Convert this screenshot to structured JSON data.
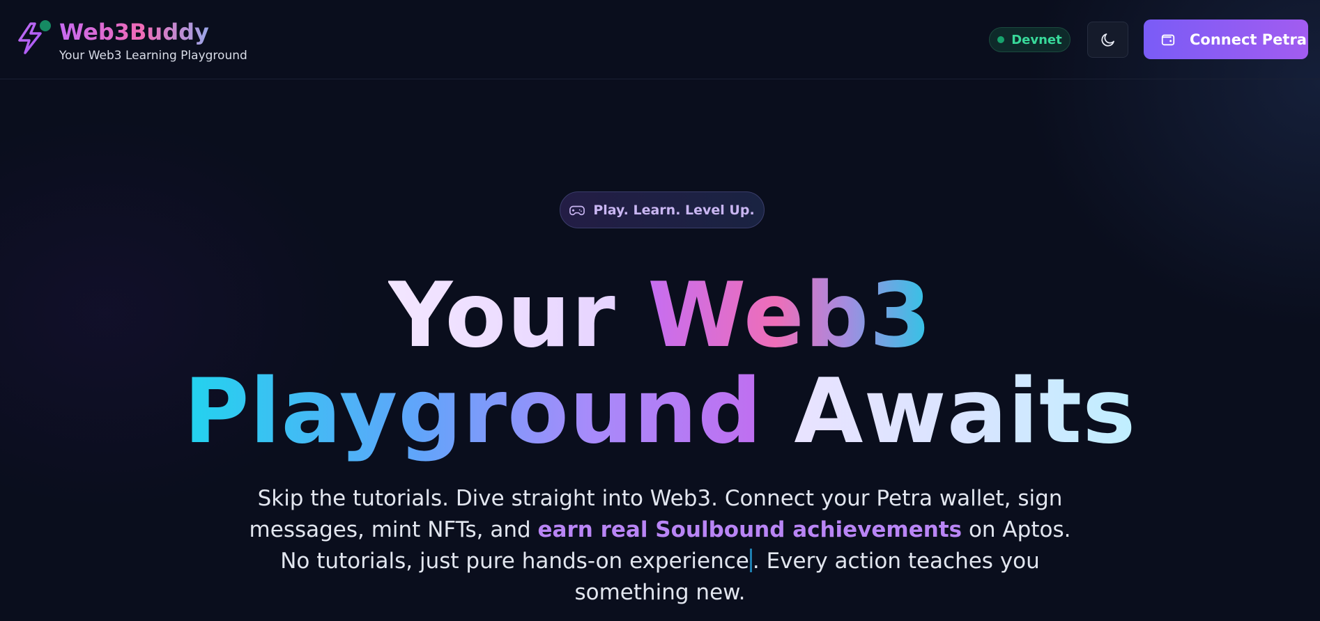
{
  "header": {
    "brand_title": "Web3Buddy",
    "brand_subtitle": "Your Web3 Learning Playground",
    "network_label": "Devnet",
    "connect_label": "Connect Petra",
    "status_color": "#17a36d",
    "accent_color": "#8b5cf6"
  },
  "hero": {
    "pill_label": "Play. Learn. Level Up.",
    "title_word_1": "Your",
    "title_word_2": "Web3",
    "title_word_3": "Playground",
    "title_word_4": "Awaits",
    "lead_part_1": "Skip the tutorials. Dive straight into Web3. Connect your Petra wallet, sign messages, mint NFTs, and",
    "lead_highlight": "earn real Soulbound achievements",
    "lead_part_2": "on Aptos.",
    "lead_part_3": "No tutorials, just pure hands-on experience",
    "lead_part_4": ". Every action teaches you something new."
  },
  "icons": {
    "logo": "bolt-icon",
    "theme_toggle": "moon-icon",
    "wallet": "wallet-icon",
    "pill": "gamepad-icon"
  }
}
